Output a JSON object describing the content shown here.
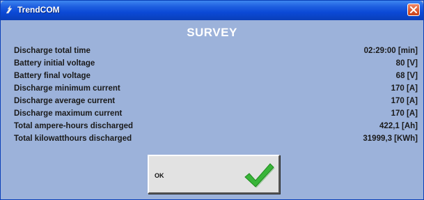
{
  "window": {
    "title": "TrendCOM",
    "icons": {
      "app": "app-logo-icon",
      "close": "close-x-icon"
    },
    "colors": {
      "titlebar": "#0b49d6",
      "background": "#9cb2da",
      "close": "#dc5a30"
    }
  },
  "survey": {
    "heading": "SURVEY",
    "rows": [
      {
        "label": "Discharge total time",
        "value": "02:29:00 [min]"
      },
      {
        "label": "Battery initial voltage",
        "value": "80 [V]"
      },
      {
        "label": "Battery final voltage",
        "value": "68 [V]"
      },
      {
        "label": "Discharge minimum current",
        "value": "170 [A]"
      },
      {
        "label": "Discharge average current",
        "value": "170 [A]"
      },
      {
        "label": "Discharge maximum current",
        "value": "170 [A]"
      },
      {
        "label": "Total ampere-hours discharged",
        "value": "422,1 [Ah]"
      },
      {
        "label": "Total kilowatthours discharged",
        "value": "31999,3 [KWh]"
      }
    ]
  },
  "ok_button": {
    "label": "OK",
    "icon": "green-checkmark-icon",
    "check_color": "#2fa82f"
  }
}
